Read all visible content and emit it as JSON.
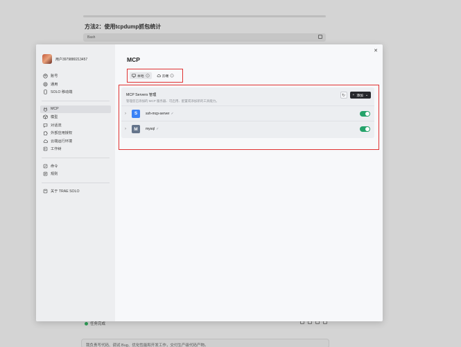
{
  "background": {
    "heading": "方法2：使用tcpdump抓包统计",
    "code_label": "Bash",
    "status_text": "任务完成",
    "input_placeholder": "我负责写代码、调试 Bug、优化性能和开发工作，交付生产级代码产物。"
  },
  "user": {
    "name": "用户3979880213457"
  },
  "sidebar": {
    "group1": [
      {
        "label": "账号",
        "icon": "user-icon"
      },
      {
        "label": "通用",
        "icon": "gear-icon"
      },
      {
        "label": "SOLO 移动端",
        "icon": "mobile-icon"
      }
    ],
    "group2": [
      {
        "label": "MCP",
        "icon": "plug-icon",
        "active": true
      },
      {
        "label": "模型",
        "icon": "cube-icon"
      },
      {
        "label": "对话流",
        "icon": "chat-icon"
      },
      {
        "label": "外部应用授权",
        "icon": "puzzle-icon"
      },
      {
        "label": "云端运行环境",
        "icon": "cloud-icon"
      },
      {
        "label": "工作树",
        "icon": "branch-icon"
      }
    ],
    "group3": [
      {
        "label": "命令",
        "icon": "command-icon"
      },
      {
        "label": "规则",
        "icon": "rules-icon"
      }
    ],
    "group4": [
      {
        "label": "关于 TRAE SOLO",
        "icon": "info-icon"
      }
    ]
  },
  "main": {
    "title": "MCP",
    "tabs": [
      {
        "label": "本地",
        "icon": "monitor-icon",
        "active": true
      },
      {
        "label": "云端",
        "icon": "cloud-icon",
        "active": false
      }
    ],
    "panel": {
      "title": "MCP Servers 管理",
      "subtitle": "管理您已添加的 MCP 服务器、可启用、配置或添加新的工具能力。",
      "add_label": "添加",
      "servers": [
        {
          "letter": "S",
          "name": "ssh-mcp-server",
          "color": "#3b82f6",
          "enabled": true
        },
        {
          "letter": "M",
          "name": "mysql",
          "color": "#64748b",
          "enabled": true
        }
      ]
    }
  },
  "colors": {
    "accent_red": "#e03131",
    "toggle_on": "#24a36a"
  }
}
